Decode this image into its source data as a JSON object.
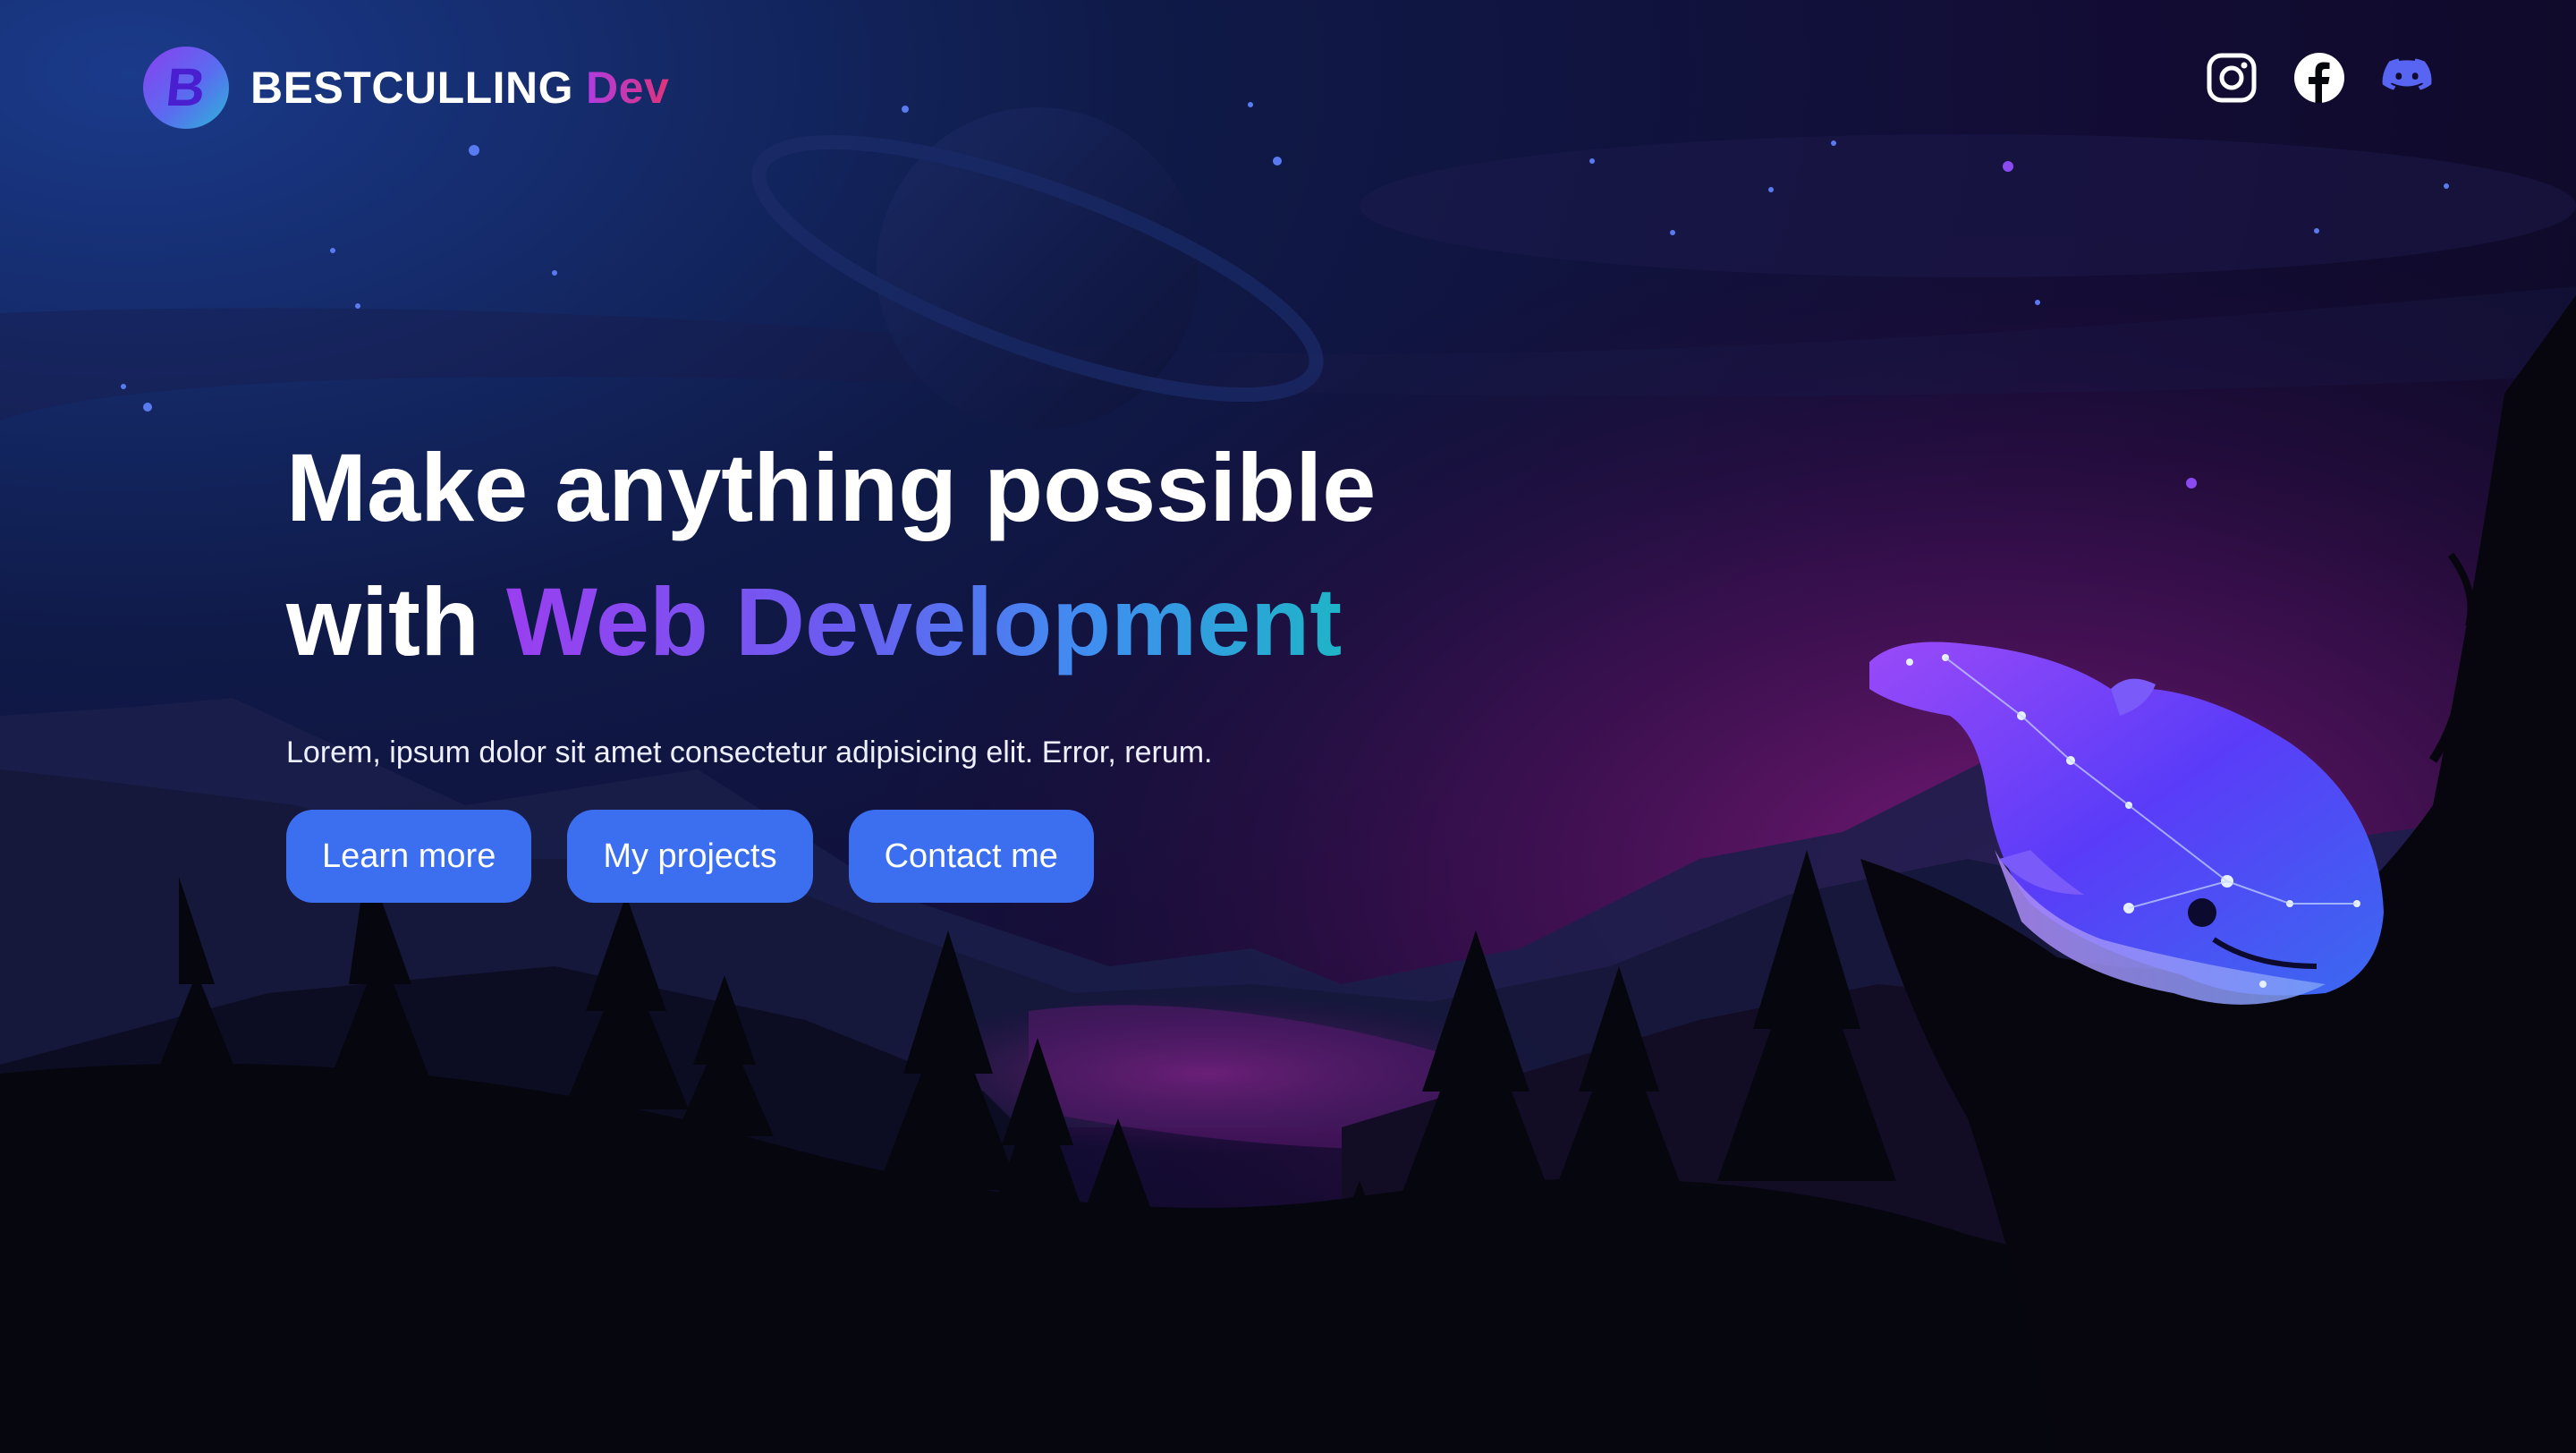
{
  "brand": {
    "logo_letter": "B",
    "name": "BESTCULLING",
    "suffix": "Dev"
  },
  "socials": [
    {
      "icon": "instagram-icon",
      "label": "Instagram",
      "color": "#ffffff"
    },
    {
      "icon": "facebook-icon",
      "label": "Facebook",
      "color": "#ffffff"
    },
    {
      "icon": "discord-icon",
      "label": "Discord",
      "color": "#5865f2"
    }
  ],
  "hero": {
    "line1": "Make anything possible",
    "line2_prefix": "with",
    "line2_highlight": "Web Development",
    "subtitle": "Lorem, ipsum dolor sit amet consectetur adipisicing elit. Error, rerum."
  },
  "buttons": {
    "learn_more": "Learn more",
    "my_projects": "My projects",
    "contact_me": "Contact me"
  },
  "colors": {
    "accent_button": "#3b6ff0",
    "gradient_start": "#9a3ff0",
    "gradient_end": "#1fb4c8",
    "brand_suffix": "#c53ab5"
  }
}
